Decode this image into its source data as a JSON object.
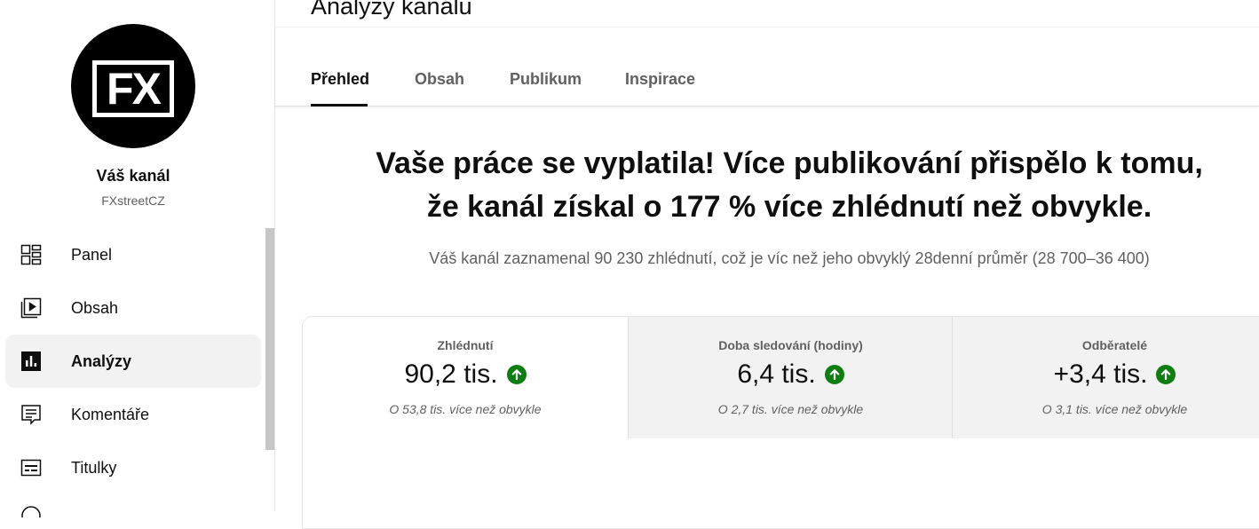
{
  "sidebar": {
    "avatar_text": "FX",
    "channel_title": "Váš kanál",
    "channel_handle": "FXstreetCZ",
    "items": [
      {
        "label": "Panel",
        "icon": "dashboard-icon"
      },
      {
        "label": "Obsah",
        "icon": "video-library-icon"
      },
      {
        "label": "Analýzy",
        "icon": "analytics-icon",
        "active": true
      },
      {
        "label": "Komentáře",
        "icon": "comment-icon"
      },
      {
        "label": "Titulky",
        "icon": "subtitles-icon"
      }
    ]
  },
  "header": {
    "title": "Analýzy kanálu",
    "tabs": [
      {
        "label": "Přehled",
        "active": true
      },
      {
        "label": "Obsah"
      },
      {
        "label": "Publikum"
      },
      {
        "label": "Inspirace"
      }
    ]
  },
  "main": {
    "headline_line1": "Vaše práce se vyplatila! Více publikování přispělo k tomu,",
    "headline_line2": "že kanál získal o 177 % více zhlédnutí než obvykle.",
    "subline": "Váš kanál zaznamenal 90 230 zhlédnutí, což je víc než jeho obvyklý 28denní průměr (28 700–36 400)",
    "cards": [
      {
        "label": "Zhlédnutí",
        "value": "90,2 tis.",
        "note": "O 53,8 tis. více než obvykle",
        "trend": "up"
      },
      {
        "label": "Doba sledování (hodiny)",
        "value": "6,4 tis.",
        "note": "O 2,7 tis. více než obvykle",
        "trend": "up"
      },
      {
        "label": "Odběratelé",
        "value": "+3,4 tis.",
        "note": "O 3,1 tis. více než obvykle",
        "trend": "up"
      }
    ]
  },
  "colors": {
    "trend_up": "#0f7d11",
    "text_primary": "#0f0f0f",
    "text_secondary": "#606060",
    "card_bg": "#f2f2f2"
  }
}
